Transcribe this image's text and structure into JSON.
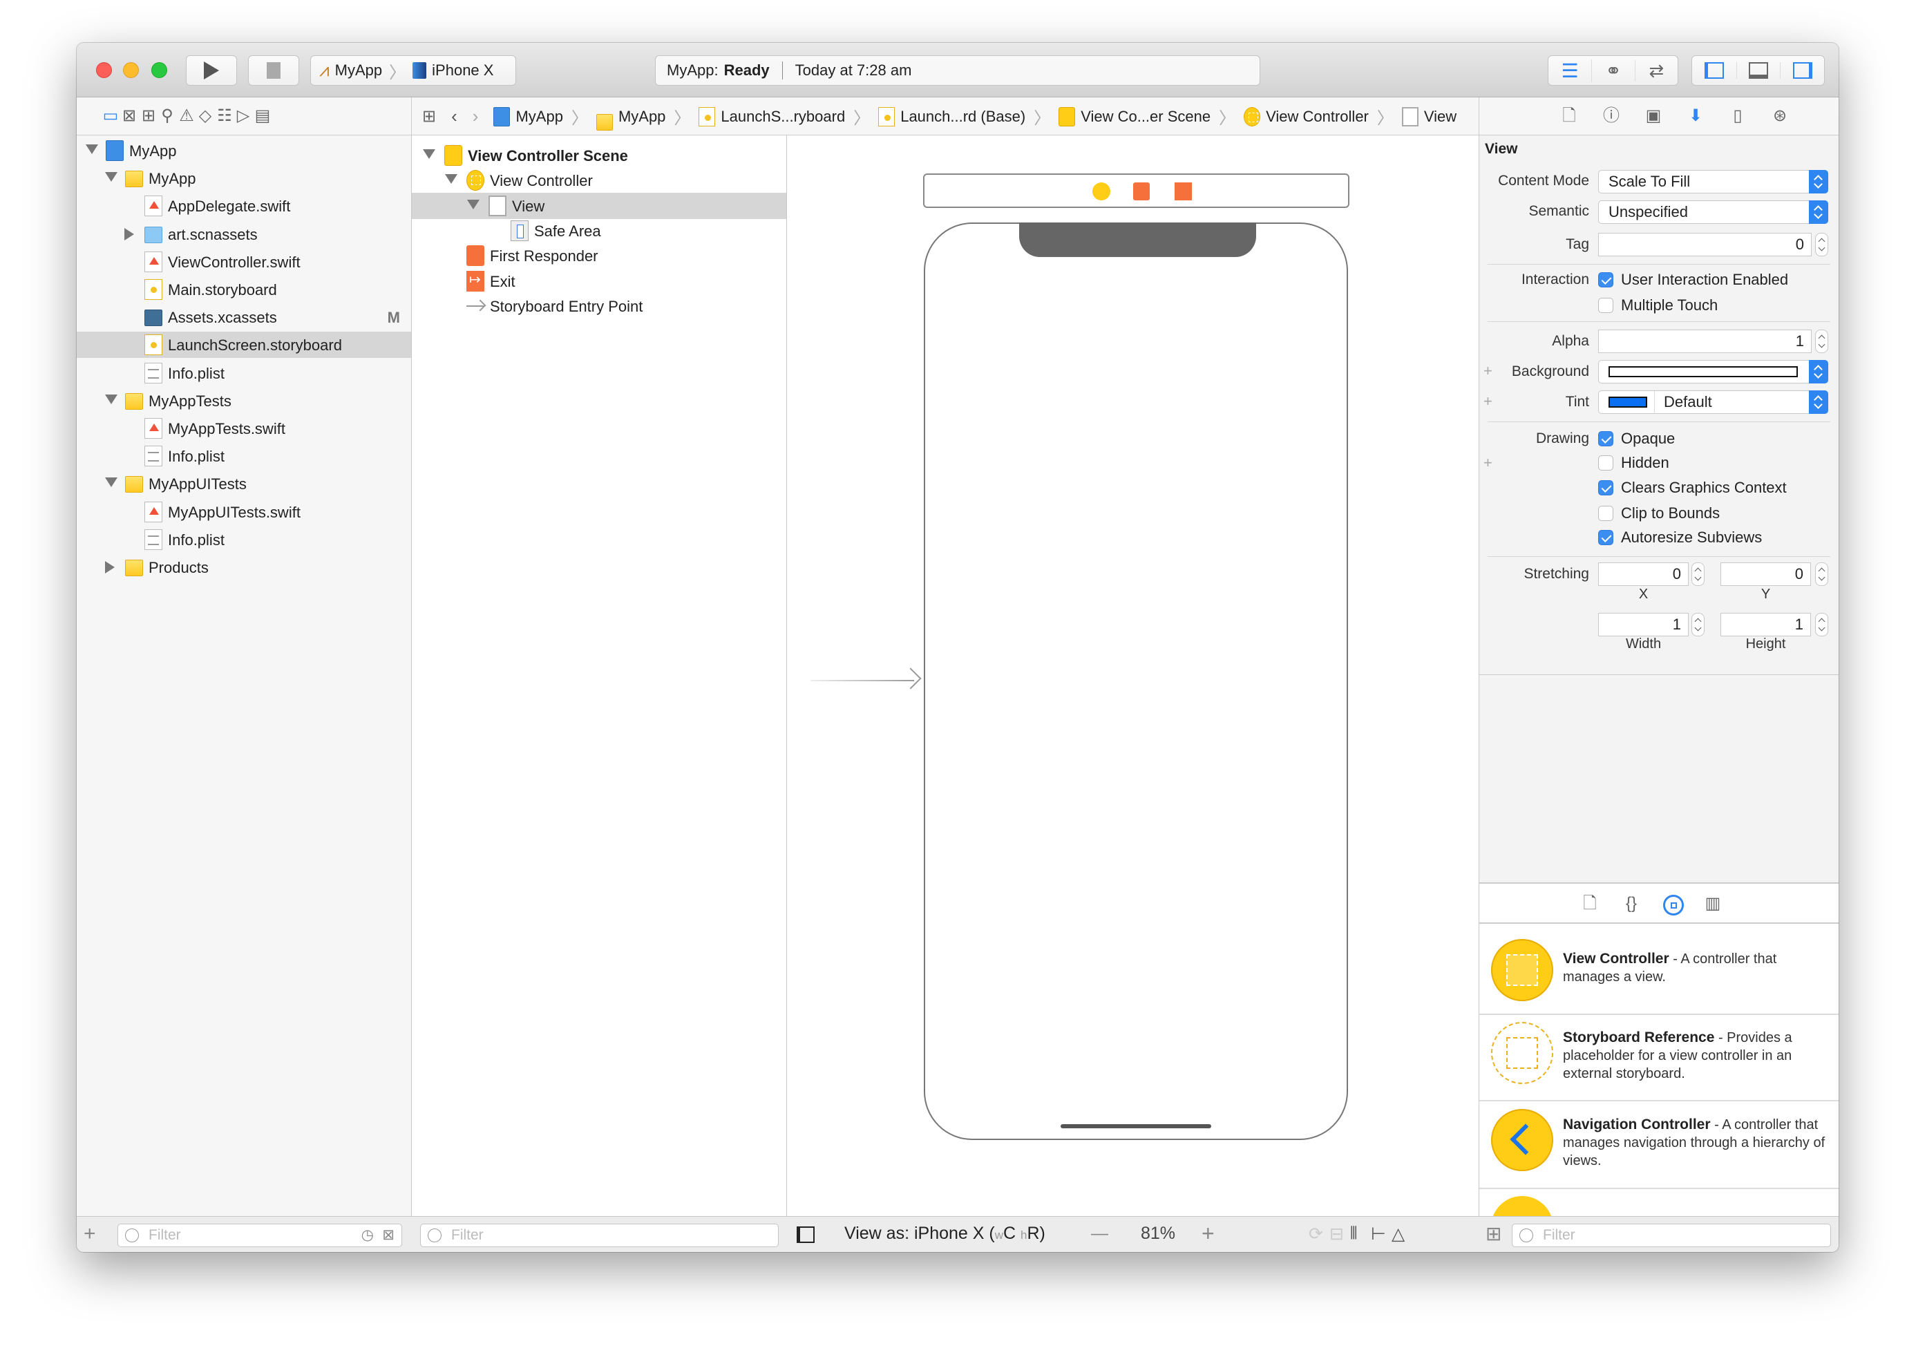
{
  "colors": {
    "accent": "#2f86f0",
    "close": "#fc5f57",
    "minimize": "#fdbc2e",
    "zoom": "#28c840",
    "folder": "#ffcc16",
    "exit": "#f5703a",
    "tint": "#0a6ff0"
  },
  "toolbar": {
    "run_icon": "play-icon",
    "stop_icon": "stop-icon",
    "scheme": "MyApp",
    "device": "iPhone X",
    "status_app": "MyApp:",
    "status_state": "Ready",
    "status_time": "Today at 7:28 am"
  },
  "breadcrumb": [
    {
      "label": "MyApp",
      "icon": "project-icon"
    },
    {
      "label": "MyApp",
      "icon": "folder-icon"
    },
    {
      "label": "LaunchS...ryboard",
      "icon": "storyboard-icon"
    },
    {
      "label": "Launch...rd (Base)",
      "icon": "storyboard-icon"
    },
    {
      "label": "View Co...er Scene",
      "icon": "scene-icon"
    },
    {
      "label": "View Controller",
      "icon": "view-controller-icon"
    },
    {
      "label": "View",
      "icon": "view-icon"
    }
  ],
  "navigator": {
    "items": [
      {
        "label": "MyApp",
        "level": 0,
        "icon": "project",
        "disc": "open"
      },
      {
        "label": "MyApp",
        "level": 1,
        "icon": "folder",
        "disc": "open"
      },
      {
        "label": "AppDelegate.swift",
        "level": 2,
        "icon": "swift"
      },
      {
        "label": "art.scnassets",
        "level": 2,
        "icon": "scn",
        "disc": "closed"
      },
      {
        "label": "ViewController.swift",
        "level": 2,
        "icon": "swift"
      },
      {
        "label": "Main.storyboard",
        "level": 2,
        "icon": "sb"
      },
      {
        "label": "Assets.xcassets",
        "level": 2,
        "icon": "xc",
        "badge": "M"
      },
      {
        "label": "LaunchScreen.storyboard",
        "level": 2,
        "icon": "sb",
        "selected": true
      },
      {
        "label": "Info.plist",
        "level": 2,
        "icon": "plist"
      },
      {
        "label": "MyAppTests",
        "level": 1,
        "icon": "folder",
        "disc": "open"
      },
      {
        "label": "MyAppTests.swift",
        "level": 2,
        "icon": "swift"
      },
      {
        "label": "Info.plist",
        "level": 2,
        "icon": "plist"
      },
      {
        "label": "MyAppUITests",
        "level": 1,
        "icon": "folder",
        "disc": "open"
      },
      {
        "label": "MyAppUITests.swift",
        "level": 2,
        "icon": "swift"
      },
      {
        "label": "Info.plist",
        "level": 2,
        "icon": "plist"
      },
      {
        "label": "Products",
        "level": 1,
        "icon": "folder",
        "disc": "closed"
      }
    ],
    "filter_placeholder": "Filter"
  },
  "outline": {
    "items": [
      {
        "label": "View Controller Scene",
        "level": 0,
        "icon": "scene",
        "disc": "open",
        "bold": true
      },
      {
        "label": "View Controller",
        "level": 1,
        "icon": "vc",
        "disc": "open"
      },
      {
        "label": "View",
        "level": 2,
        "icon": "view",
        "disc": "open",
        "selected": true
      },
      {
        "label": "Safe Area",
        "level": 3,
        "icon": "safe"
      },
      {
        "label": "First Responder",
        "level": 1,
        "icon": "resp"
      },
      {
        "label": "Exit",
        "level": 1,
        "icon": "exit"
      },
      {
        "label": "Storyboard Entry Point",
        "level": 1,
        "icon": "entry"
      }
    ],
    "filter_placeholder": "Filter"
  },
  "canvas": {
    "view_as": "View as: iPhone X (",
    "size_w": "w",
    "size_c": "C ",
    "size_h": "h",
    "size_r": "R)",
    "zoom_out": "—",
    "zoom": "81%",
    "zoom_in": "+"
  },
  "inspector": {
    "section": "View",
    "content_mode_label": "Content Mode",
    "content_mode": "Scale To Fill",
    "semantic_label": "Semantic",
    "semantic": "Unspecified",
    "tag_label": "Tag",
    "tag": "0",
    "interaction_label": "Interaction",
    "user_interaction": {
      "label": "User Interaction Enabled",
      "checked": true
    },
    "multiple_touch": {
      "label": "Multiple Touch",
      "checked": false
    },
    "alpha_label": "Alpha",
    "alpha": "1",
    "background_label": "Background",
    "background_color": "#ffffff",
    "tint_label": "Tint",
    "tint": "Default",
    "drawing_label": "Drawing",
    "opaque": {
      "label": "Opaque",
      "checked": true
    },
    "hidden": {
      "label": "Hidden",
      "checked": false
    },
    "clears": {
      "label": "Clears Graphics Context",
      "checked": true
    },
    "clip": {
      "label": "Clip to Bounds",
      "checked": false
    },
    "autoresize": {
      "label": "Autoresize Subviews",
      "checked": true
    },
    "stretching_label": "Stretching",
    "stretch_x": "0",
    "stretch_y": "0",
    "stretch_w": "1",
    "stretch_h": "1",
    "x_label": "X",
    "y_label": "Y",
    "width_label": "Width",
    "height_label": "Height"
  },
  "library": {
    "items": [
      {
        "title": "View Controller",
        "desc": " - A controller that manages a view."
      },
      {
        "title": "Storyboard Reference",
        "desc": " - Provides a placeholder for a view controller in an external storyboard."
      },
      {
        "title": "Navigation Controller",
        "desc": " - A controller that manages navigation through a hierarchy of views."
      }
    ],
    "filter_placeholder": "Filter"
  }
}
